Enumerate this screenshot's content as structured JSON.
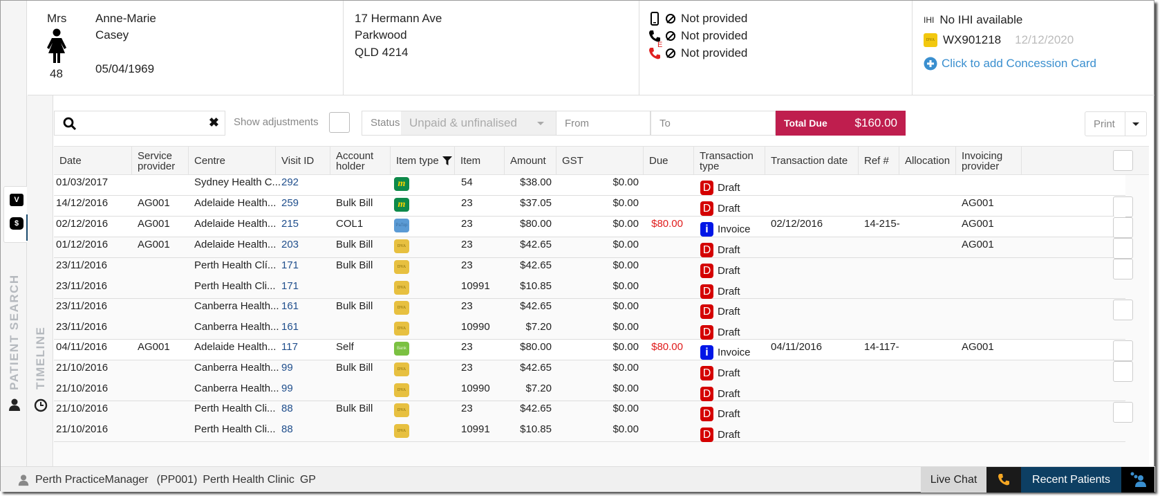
{
  "patient": {
    "title": "Mrs",
    "age": "48",
    "first_name": "Anne-Marie",
    "last_name": "Casey",
    "dob": "05/04/1969",
    "address_line1": "17 Hermann Ave",
    "address_line2": "Parkwood",
    "address_line3": "QLD 4214",
    "mobile": "Not provided",
    "phone": "Not provided",
    "emergency_phone": "Not provided",
    "emergency_label": "E",
    "ihi_label": "IHI",
    "ihi": "No IHI available",
    "dva_badge": "DVA",
    "dva_number": "WX901218",
    "dva_expiry": "12/12/2020",
    "add_concession": "Click to add Concession Card"
  },
  "left_nav": {
    "tab_visit": "V",
    "tab_billing": "$",
    "patient_search": "PATIENT SEARCH",
    "timeline": "TIMELINE"
  },
  "toolbar": {
    "search_value": "",
    "show_adjustments_label": "Show adjustments",
    "status_label": "Status",
    "status_value": "Unpaid & unfinalised",
    "from_placeholder": "From",
    "to_placeholder": "To",
    "total_due_label": "Total Due",
    "total_due_value": "$160.00",
    "print_label": "Print"
  },
  "table": {
    "columns": [
      "Date",
      "Service provider",
      "Centre",
      "Visit ID",
      "Account holder",
      "Item type",
      "Item",
      "Amount",
      "GST",
      "Due",
      "Transaction type",
      "Transaction date",
      "Ref #",
      "Allocation",
      "Invoicing provider"
    ],
    "groups": [
      {
        "rows": [
          {
            "date": "01/03/2017",
            "provider": "",
            "centre": "Sydney Health C...",
            "visit_id": "292",
            "holder": "",
            "item_type": "medicare",
            "item_type_label": "m",
            "item": "54",
            "amount": "$38.00",
            "gst": "$0.00",
            "due": "",
            "tx_type": "Draft",
            "tx_badge": "D",
            "tx_date": "",
            "ref": "",
            "allocation": "",
            "inv_provider": ""
          }
        ],
        "checkbox": false
      },
      {
        "rows": [
          {
            "date": "14/12/2016",
            "provider": "AG001",
            "centre": "Adelaide Health...",
            "visit_id": "259",
            "holder": "Bulk Bill",
            "item_type": "medicare",
            "item_type_label": "m",
            "item": "23",
            "amount": "$37.05",
            "gst": "$0.00",
            "due": "",
            "tx_type": "Draft",
            "tx_badge": "D",
            "tx_date": "",
            "ref": "",
            "allocation": "",
            "inv_provider": "AG001"
          }
        ],
        "checkbox": true
      },
      {
        "rows": [
          {
            "date": "02/12/2016",
            "provider": "AG001",
            "centre": "Adelaide Health...",
            "visit_id": "215",
            "holder": "COL1",
            "item_type": "payment",
            "item_type_label": "PaTop",
            "item": "23",
            "amount": "$80.00",
            "gst": "$0.00",
            "due": "$80.00",
            "tx_type": "Invoice",
            "tx_badge": "i",
            "tx_date": "02/12/2016",
            "ref": "14-215-",
            "allocation": "",
            "inv_provider": "AG001"
          }
        ],
        "checkbox": true
      },
      {
        "rows": [
          {
            "date": "01/12/2016",
            "provider": "AG001",
            "centre": "Adelaide Health...",
            "visit_id": "203",
            "holder": "Bulk Bill",
            "item_type": "dva",
            "item_type_label": "DVA",
            "item": "23",
            "amount": "$42.65",
            "gst": "$0.00",
            "due": "",
            "tx_type": "Draft",
            "tx_badge": "D",
            "tx_date": "",
            "ref": "",
            "allocation": "",
            "inv_provider": "AG001"
          }
        ],
        "checkbox": true
      },
      {
        "rows": [
          {
            "date": "23/11/2016",
            "provider": "",
            "centre": "Perth Health Clí...",
            "visit_id": "171",
            "holder": "Bulk Bill",
            "item_type": "dva",
            "item_type_label": "DVA",
            "item": "23",
            "amount": "$42.65",
            "gst": "$0.00",
            "due": "",
            "tx_type": "Draft",
            "tx_badge": "D",
            "tx_date": "",
            "ref": "",
            "allocation": "",
            "inv_provider": ""
          },
          {
            "date": "23/11/2016",
            "provider": "",
            "centre": "Perth Health Cli...",
            "visit_id": "171",
            "holder": "",
            "item_type": "dva",
            "item_type_label": "DVA",
            "item": "10991",
            "amount": "$10.85",
            "gst": "$0.00",
            "due": "",
            "tx_type": "Draft",
            "tx_badge": "D",
            "tx_date": "",
            "ref": "",
            "allocation": "",
            "inv_provider": ""
          }
        ],
        "checkbox": true
      },
      {
        "rows": [
          {
            "date": "23/11/2016",
            "provider": "",
            "centre": "Canberra Health...",
            "visit_id": "161",
            "holder": "Bulk Bill",
            "item_type": "dva",
            "item_type_label": "DVA",
            "item": "23",
            "amount": "$42.65",
            "gst": "$0.00",
            "due": "",
            "tx_type": "Draft",
            "tx_badge": "D",
            "tx_date": "",
            "ref": "",
            "allocation": "",
            "inv_provider": ""
          },
          {
            "date": "23/11/2016",
            "provider": "",
            "centre": "Canberra Health...",
            "visit_id": "161",
            "holder": "",
            "item_type": "dva",
            "item_type_label": "DVA",
            "item": "10990",
            "amount": "$7.20",
            "gst": "$0.00",
            "due": "",
            "tx_type": "Draft",
            "tx_badge": "D",
            "tx_date": "",
            "ref": "",
            "allocation": "",
            "inv_provider": ""
          }
        ],
        "checkbox": true
      },
      {
        "rows": [
          {
            "date": "04/11/2016",
            "provider": "AG001",
            "centre": "Adelaide Health...",
            "visit_id": "117",
            "holder": "Self",
            "item_type": "bank",
            "item_type_label": "Bank",
            "item": "23",
            "amount": "$80.00",
            "gst": "$0.00",
            "due": "$80.00",
            "tx_type": "Invoice",
            "tx_badge": "i",
            "tx_date": "04/11/2016",
            "ref": "14-117-",
            "allocation": "",
            "inv_provider": "AG001"
          }
        ],
        "checkbox": true
      },
      {
        "rows": [
          {
            "date": "21/10/2016",
            "provider": "",
            "centre": "Canberra Health...",
            "visit_id": "99",
            "holder": "Bulk Bill",
            "item_type": "dva",
            "item_type_label": "DVA",
            "item": "23",
            "amount": "$42.65",
            "gst": "$0.00",
            "due": "",
            "tx_type": "Draft",
            "tx_badge": "D",
            "tx_date": "",
            "ref": "",
            "allocation": "",
            "inv_provider": ""
          },
          {
            "date": "21/10/2016",
            "provider": "",
            "centre": "Canberra Health...",
            "visit_id": "99",
            "holder": "",
            "item_type": "dva",
            "item_type_label": "DVA",
            "item": "10990",
            "amount": "$7.20",
            "gst": "$0.00",
            "due": "",
            "tx_type": "Draft",
            "tx_badge": "D",
            "tx_date": "",
            "ref": "",
            "allocation": "",
            "inv_provider": ""
          }
        ],
        "checkbox": true
      },
      {
        "rows": [
          {
            "date": "21/10/2016",
            "provider": "",
            "centre": "Perth Health Cli...",
            "visit_id": "88",
            "holder": "Bulk Bill",
            "item_type": "dva",
            "item_type_label": "DVA",
            "item": "23",
            "amount": "$42.65",
            "gst": "$0.00",
            "due": "",
            "tx_type": "Draft",
            "tx_badge": "D",
            "tx_date": "",
            "ref": "",
            "allocation": "",
            "inv_provider": ""
          },
          {
            "date": "21/10/2016",
            "provider": "",
            "centre": "Perth Health Cli...",
            "visit_id": "88",
            "holder": "",
            "item_type": "dva",
            "item_type_label": "DVA",
            "item": "10991",
            "amount": "$10.85",
            "gst": "$0.00",
            "due": "",
            "tx_type": "Draft",
            "tx_badge": "D",
            "tx_date": "",
            "ref": "",
            "allocation": "",
            "inv_provider": ""
          }
        ],
        "checkbox": true
      }
    ]
  },
  "footer": {
    "user": "Perth PracticeManager",
    "user_code": "(PP001)",
    "clinic": "Perth Health Clinic",
    "role": "GP",
    "live_chat": "Live Chat",
    "recent_patients": "Recent Patients"
  },
  "colors": {
    "total_due_bg": "#bf1e4e",
    "draft_badge": "#d40000",
    "invoice_badge": "#0016e6",
    "due_text": "#e01b1b",
    "link": "#3a8fcf",
    "recent_patients_bg": "#0d3f63",
    "phone_icon": "#f5a623"
  }
}
